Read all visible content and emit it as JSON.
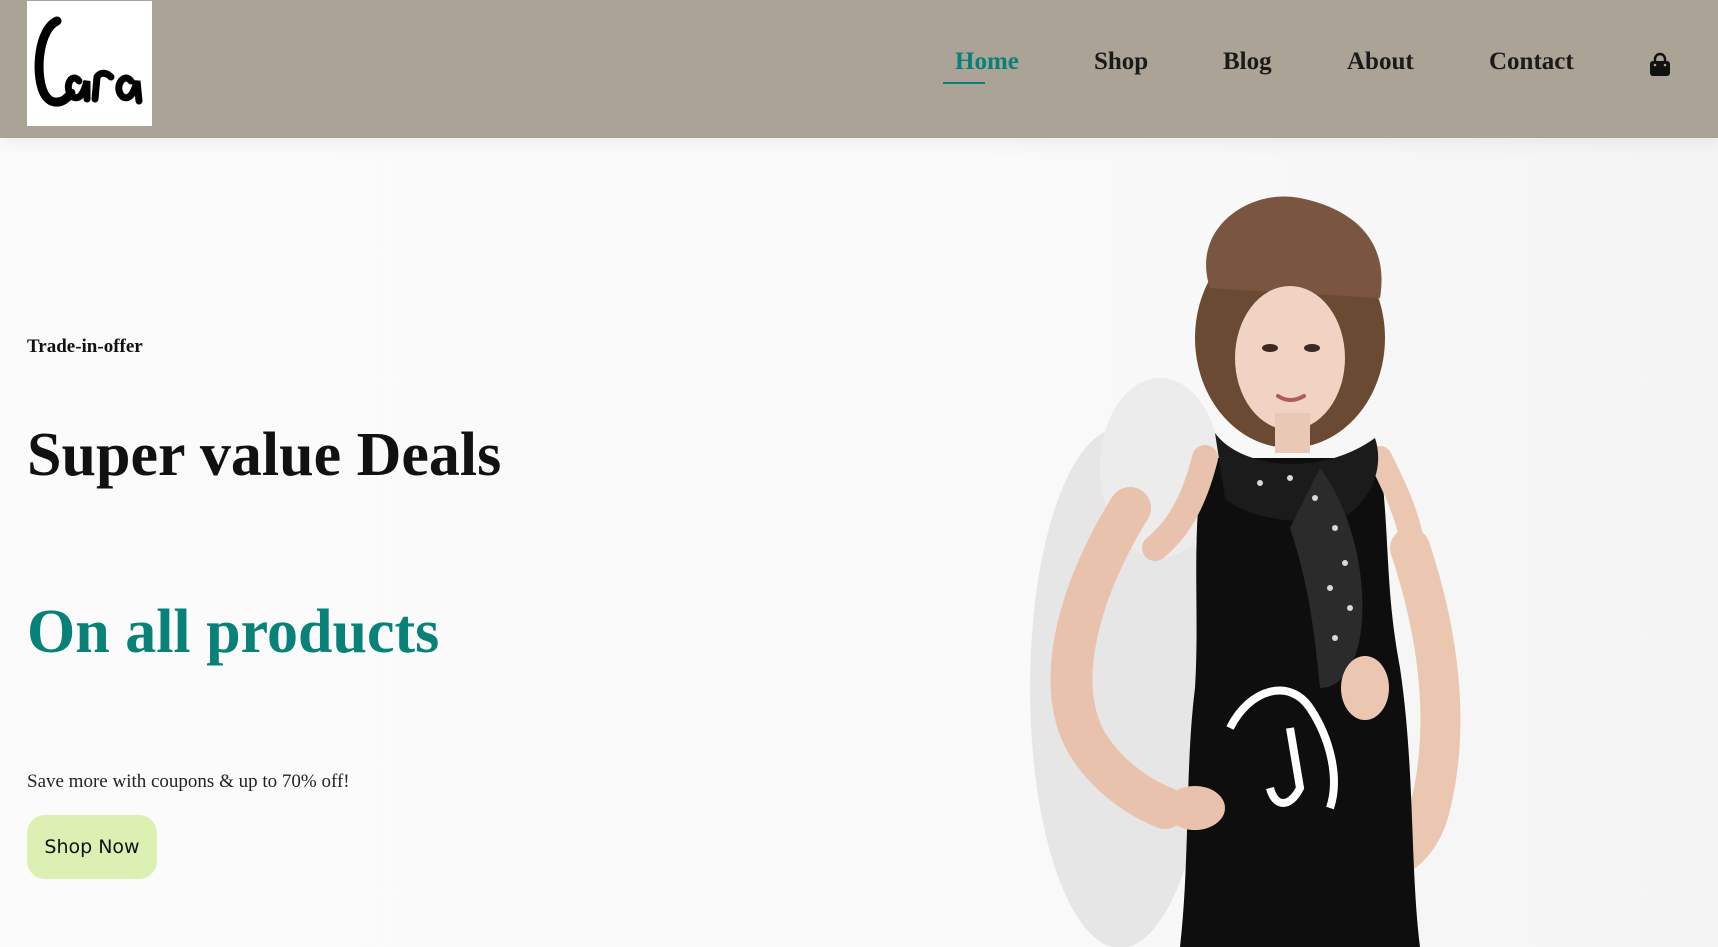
{
  "header": {
    "logo_text": "Cara",
    "nav": [
      {
        "label": "Home",
        "active": true
      },
      {
        "label": "Shop",
        "active": false
      },
      {
        "label": "Blog",
        "active": false
      },
      {
        "label": "About",
        "active": false
      },
      {
        "label": "Contact",
        "active": false
      }
    ],
    "cart_icon": "shopping-bag-icon"
  },
  "hero": {
    "kicker": "Trade-in-offer",
    "title": "Super value Deals",
    "subtitle": "On all products",
    "description": "Save more with coupons & up to 70% off!",
    "button_label": "Shop Now",
    "image_subject": "model-photo"
  },
  "colors": {
    "header_bg": "#aba396",
    "accent": "#088178",
    "button_bg": "#dcf0b4",
    "text": "#111111"
  }
}
